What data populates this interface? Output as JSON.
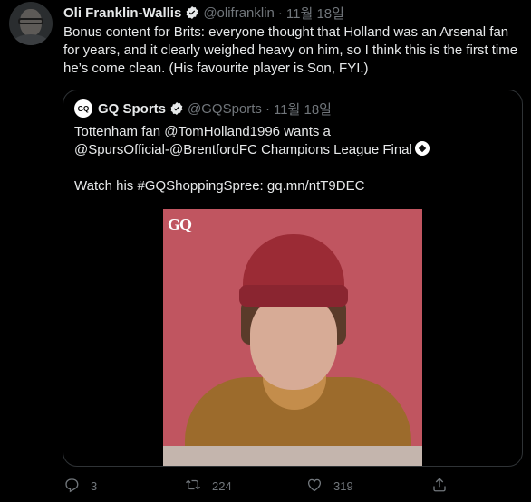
{
  "tweet": {
    "author_name": "Oli Franklin-Wallis",
    "author_handle": "@olifranklin",
    "date": "11월 18일",
    "separator": "·",
    "text": "Bonus content for Brits: everyone thought that Holland was an Arsenal fan for years, and it clearly weighed heavy on him, so I think this is the first time he’s come clean. (His favourite player is Son, FYI.)"
  },
  "quoted": {
    "avatar_text": "GQ",
    "author_name": "GQ Sports",
    "author_handle": "@GQSports",
    "date": "11월 18일",
    "separator": "·",
    "line1": "Tottenham fan @TomHolland1996 wants a",
    "line2": "@SpursOfficial-@BrentfordFC Champions League Final",
    "line3": "Watch his #GQShoppingSpree: gq.mn/ntT9DEC",
    "media_logo": "GQ"
  },
  "actions": {
    "reply_count": "3",
    "retweet_count": "224",
    "like_count": "319"
  },
  "icons": {
    "verified": "verified-badge-icon",
    "reply": "reply-icon",
    "retweet": "retweet-icon",
    "like": "heart-icon",
    "share": "share-icon",
    "soccer_ball": "soccer-ball-icon"
  },
  "colors": {
    "background": "#000000",
    "text": "#e7e9ea",
    "secondary": "#71767b",
    "border": "#2f3336",
    "media_background": "#c05560"
  }
}
